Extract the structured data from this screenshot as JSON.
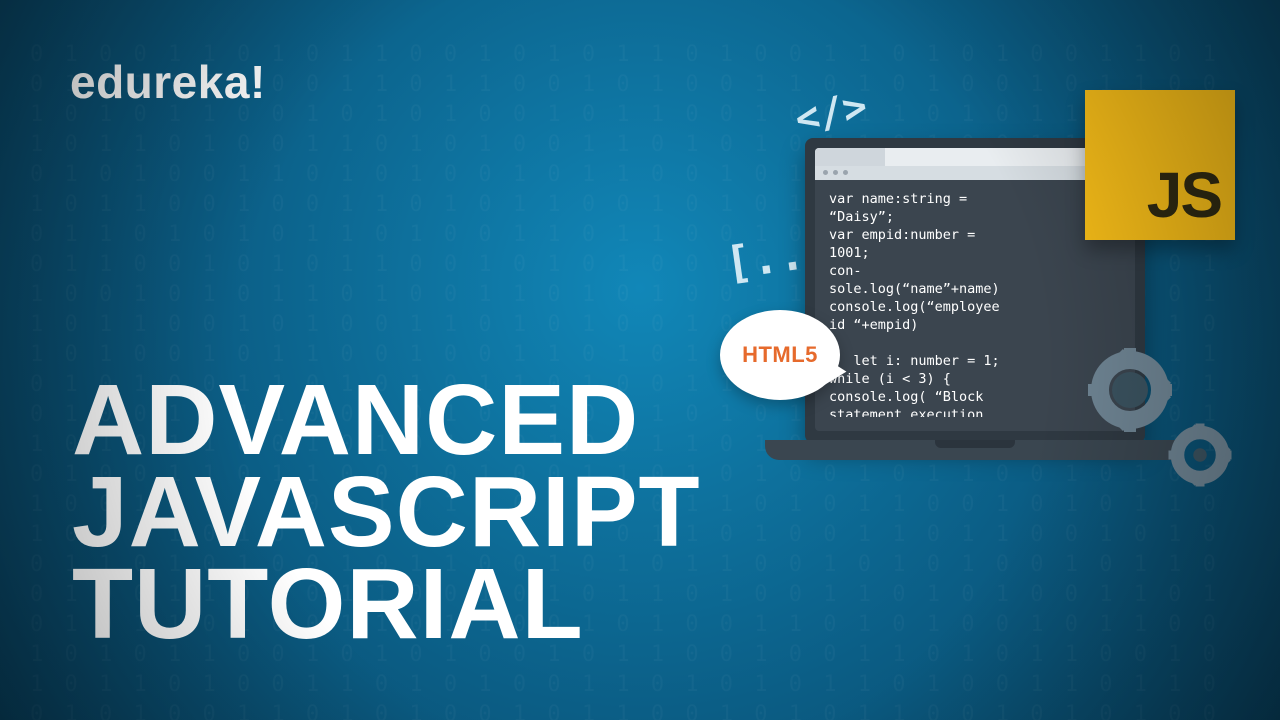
{
  "logo": {
    "brand": "edureka",
    "bang": "!"
  },
  "title": {
    "l1": "ADVANCED",
    "l2": "JAVASCRIPT",
    "l3": "TUTORIAL"
  },
  "illustration": {
    "js_badge": "JS",
    "deco_tag": "</>",
    "deco_bracket": "[...]",
    "bubble_text": "HTML5",
    "code": "var name:string =\n“Daisy”;\nvar empid:number =\n1001;\ncon-\nsole.log(“name”+name)\nconsole.log(“employee\nid “+empid)\n\n   let i: number = 1;\nwhile (i < 3) {\nconsole.log( “Block\nstatement execution\nno.” + i )\ni++;"
  },
  "colors": {
    "bg_primary": "#0b5e86",
    "accent_js": "#f5bc18",
    "accent_html5": "#e66a2c"
  }
}
